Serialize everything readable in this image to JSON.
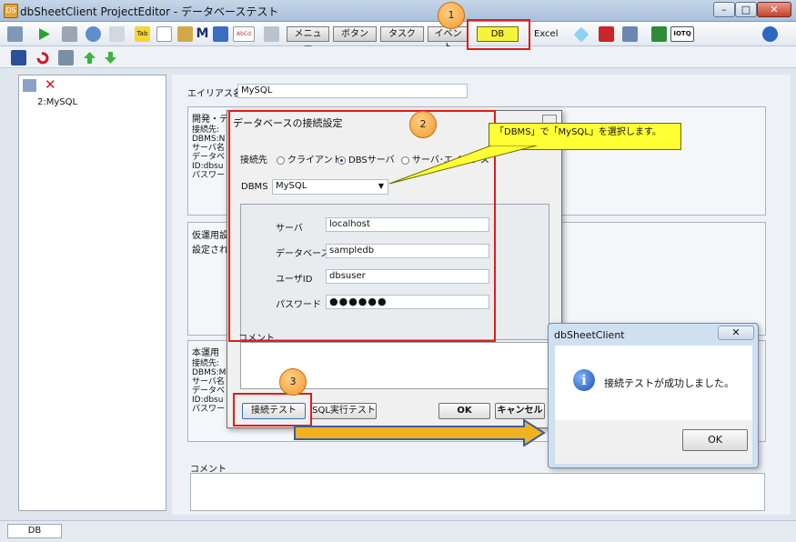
{
  "window": {
    "title": "dbSheetClient ProjectEditor - データベーステスト",
    "app_icon": "DS",
    "buttons": {
      "min": "–",
      "max": "□",
      "close": "✕"
    }
  },
  "toolbar1": {
    "tabs": [
      "メニュー",
      "ボタン",
      "タスク",
      "イベント",
      "DB",
      "Excel"
    ],
    "icon_labels": {
      "tab": "Tab",
      "m": "M",
      "abc": "AbCd",
      "iotq": "IOTQ"
    }
  },
  "leftpane": {
    "tree_item": "2:MySQL"
  },
  "rightpane": {
    "alias_label": "エイリアス名",
    "alias_value": "MySQL",
    "dev_group_title": "開発・デバ",
    "dev_lines": [
      "接続先:",
      "DBMS:N",
      "サーバ名",
      "データベ",
      "ID:dbsu",
      "パスワード"
    ],
    "temp_group_title": "仮運用設",
    "temp_line": "設定され",
    "prod_group_title": "本運用",
    "prod_lines": [
      "接続先:",
      "DBMS:M",
      "サーバ名",
      "データベ",
      "ID:dbsu",
      "パスワード"
    ],
    "comment_label": "コメント"
  },
  "status": {
    "db": "DB"
  },
  "dialog": {
    "title": "データベースの接続設定",
    "target_label": "接続先",
    "radio_client": "クライアント",
    "radio_server": "DBSサーバ",
    "radio_alias": "サーバ･エイリアス",
    "dbms_label": "DBMS",
    "dbms_value": "MySQL",
    "server_label": "サーバ",
    "server_value": "localhost",
    "database_label": "データベース",
    "database_value": "sampledb",
    "userid_label": "ユーザID",
    "userid_value": "dbsuser",
    "password_label": "パスワード",
    "password_value": "●●●●●●",
    "comment_label": "コメント",
    "btn_test": "接続テスト",
    "btn_sql": "SQL実行テスト",
    "btn_ok": "OK",
    "btn_cancel": "キャンセル"
  },
  "msgbox": {
    "title": "dbSheetClient",
    "message": "接続テストが成功しました。",
    "ok": "OK",
    "close": "✕",
    "icon": "i"
  },
  "annotations": {
    "badge1": "1",
    "badge2": "2",
    "badge3": "3",
    "callout": "「DBMS」で「MySQL」を選択します。"
  }
}
